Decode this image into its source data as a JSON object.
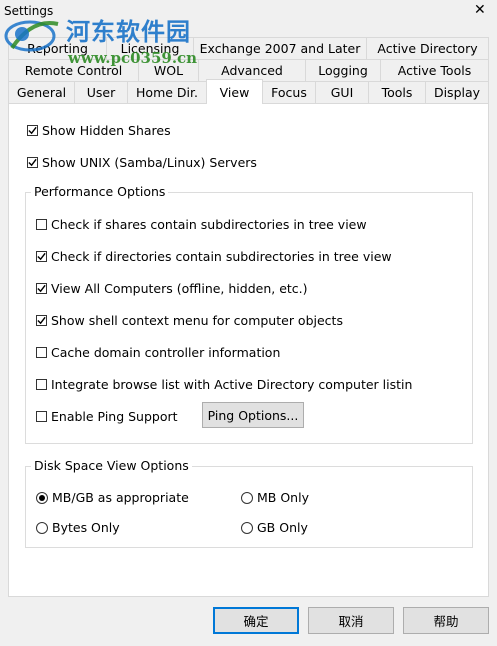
{
  "window": {
    "title": "Settings",
    "close_glyph": "✕"
  },
  "watermark": {
    "site_name": "河东软件园",
    "url": "www.pc0359.cn"
  },
  "tabs": {
    "row1": [
      "Reporting",
      "Licensing",
      "Exchange 2007 and Later",
      "Active Directory"
    ],
    "row2": [
      "Remote Control",
      "WOL",
      "Advanced",
      "Logging",
      "Active Tools"
    ],
    "row3": [
      "General",
      "User",
      "Home Dir.",
      "View",
      "Focus",
      "GUI",
      "Tools",
      "Display"
    ],
    "active": "View"
  },
  "options": {
    "show_hidden_shares": {
      "label": "Show Hidden Shares",
      "checked": true
    },
    "show_unix_servers": {
      "label": "Show UNIX (Samba/Linux) Servers",
      "checked": true
    }
  },
  "performance": {
    "title": "Performance Options",
    "items": [
      {
        "label": "Check if shares contain subdirectories in tree view",
        "checked": false
      },
      {
        "label": "Check if directories contain subdirectories in tree view",
        "checked": true
      },
      {
        "label": "View All Computers (offline, hidden, etc.)",
        "checked": true
      },
      {
        "label": "Show shell context menu for computer objects",
        "checked": true
      },
      {
        "label": "Cache domain controller information",
        "checked": false
      },
      {
        "label": "Integrate browse list with Active Directory computer listin",
        "checked": false
      },
      {
        "label": "Enable Ping Support",
        "checked": false
      }
    ],
    "ping_button": "Ping Options..."
  },
  "disk_space": {
    "title": "Disk Space View Options",
    "radios": [
      {
        "label": "MB/GB as appropriate",
        "selected": true
      },
      {
        "label": "MB Only",
        "selected": false
      },
      {
        "label": "Bytes Only",
        "selected": false
      },
      {
        "label": "GB Only",
        "selected": false
      }
    ]
  },
  "buttons": {
    "ok": "确定",
    "cancel": "取消",
    "help": "帮助"
  },
  "colors": {
    "accent": "#0078d7",
    "watermark_blue": "#1a73c9",
    "watermark_green": "#2e8b25"
  }
}
